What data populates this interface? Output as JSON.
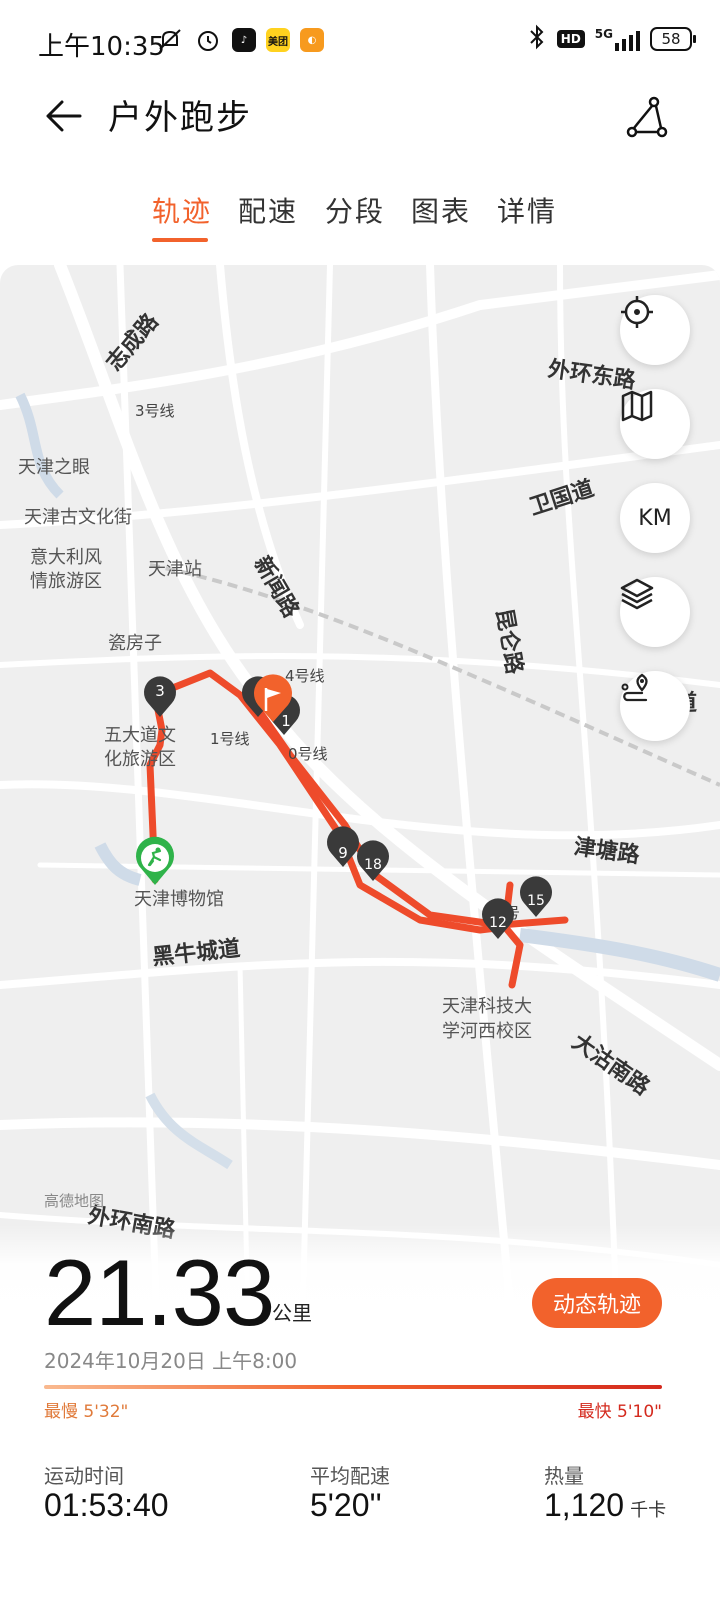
{
  "status_bar": {
    "time": "上午10:35",
    "app_icons": [
      "mute-icon",
      "alarm-icon",
      "tiktok-icon",
      "meituan-icon",
      "other-app-icon"
    ],
    "meituan_label": "美团",
    "right_icons": [
      "bluetooth-icon",
      "hd-icon",
      "5g-signal-icon",
      "battery-icon"
    ],
    "hd_label": "HD",
    "network": "5G",
    "battery": "58"
  },
  "header": {
    "title": "户外跑步"
  },
  "tabs": [
    {
      "label": "轨迹",
      "active": true
    },
    {
      "label": "配速",
      "active": false
    },
    {
      "label": "分段",
      "active": false
    },
    {
      "label": "图表",
      "active": false
    },
    {
      "label": "详情",
      "active": false
    }
  ],
  "map": {
    "labels": {
      "zhicheng": "志成路",
      "line3": "3号线",
      "tianjin_eye": "天津之眼",
      "ancient_street": "天津古文化街",
      "italian_1": "意大利风",
      "italian_2": "情旅游区",
      "station": "天津站",
      "cifangzi": "瓷房子",
      "wudadao_1": "五大道文",
      "wudadao_2": "化旅游区",
      "line1": "1号线",
      "line4": "4号线",
      "line10": "0号线",
      "xinwei": "新闻路",
      "waihuan_east": "外环东路",
      "weiguo": "卫国道",
      "kunlun": "昆仑路",
      "jintang": "津塘路",
      "museum": "天津博物馆",
      "heiniucheng": "黑牛城道",
      "tust_1": "天津科技大",
      "tust_2": "学河西校区",
      "dagu": "大沽南路",
      "waihuan_south": "外环南路",
      "dao": "道",
      "amap": "高德地图",
      "line_num": "号"
    },
    "km_markers": [
      "3",
      "9",
      "18",
      "12",
      "15",
      "1"
    ],
    "controls": [
      {
        "name": "locate-button",
        "icon": "crosshair-icon"
      },
      {
        "name": "map-mode-button",
        "icon": "map-icon"
      },
      {
        "name": "km-toggle-button",
        "label": "KM"
      },
      {
        "name": "layers-button",
        "icon": "layers-icon"
      },
      {
        "name": "route-button",
        "icon": "route-pin-icon"
      }
    ],
    "route_color": "#ee4b2b"
  },
  "summary": {
    "distance": "21.33",
    "distance_unit": "公里",
    "dynamic_track_label": "动态轨迹",
    "date": "2024年10月20日 上午8:00",
    "slowest_label": "最慢 5'32\"",
    "fastest_label": "最快 5'10\"",
    "stats": [
      {
        "label": "运动时间",
        "value": "01:53:40",
        "unit": ""
      },
      {
        "label": "平均配速",
        "value": "5'20''",
        "unit": ""
      },
      {
        "label": "热量",
        "value": "1,120",
        "unit": "千卡"
      }
    ]
  },
  "colors": {
    "accent": "#f2622c",
    "route": "#ee4b2b",
    "marker": "#3a3a3a",
    "start": "#2fb34a"
  }
}
